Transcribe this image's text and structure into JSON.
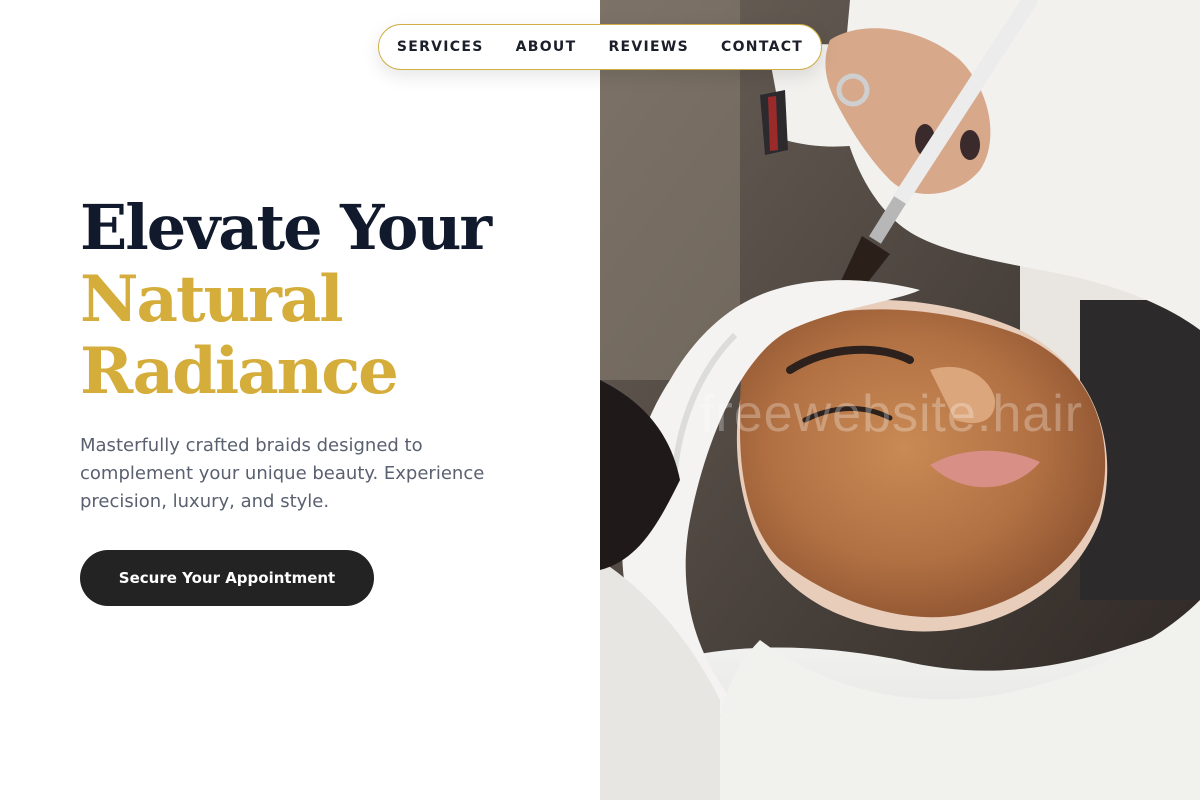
{
  "nav": {
    "items": [
      "SERVICES",
      "ABOUT",
      "REVIEWS",
      "CONTACT"
    ]
  },
  "hero": {
    "title_line1": "Elevate Your",
    "title_line2": "Natural",
    "title_line3": "Radiance",
    "description": "Masterfully crafted braids designed to complement your unique beauty. Experience precision, luxury, and style.",
    "cta_label": "Secure Your Appointment"
  },
  "image": {
    "watermark": "freewebsite.hair"
  },
  "colors": {
    "accent_gold": "#d4ad3b",
    "heading_navy": "#111a2c",
    "body_text": "#596070",
    "button_bg": "#232323"
  }
}
